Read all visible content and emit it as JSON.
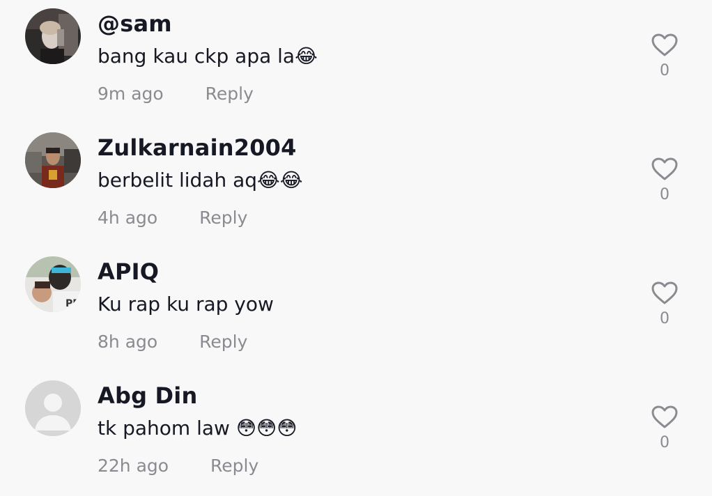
{
  "comments": [
    {
      "username": "@sam",
      "text": "bang kau ckp apa la😂",
      "time": "9m ago",
      "reply_label": "Reply",
      "like_count": "0"
    },
    {
      "username": "Zulkarnain2004",
      "text": "berbelit lidah aq😂😂",
      "time": "4h ago",
      "reply_label": "Reply",
      "like_count": "0"
    },
    {
      "username": "APIQ",
      "text": "Ku rap ku rap yow",
      "time": "8h ago",
      "reply_label": "Reply",
      "like_count": "0"
    },
    {
      "username": "Abg Din",
      "text": "tk pahom law 😳😳😳",
      "time": "22h ago",
      "reply_label": "Reply",
      "like_count": "0"
    }
  ],
  "icons": {
    "like": "heart-outline-icon",
    "default_avatar": "person-placeholder-icon"
  },
  "colors": {
    "background": "#f8f8f8",
    "username": "#161823",
    "secondary_text": "#8a8b91",
    "heart_stroke": "#8a8b91"
  }
}
